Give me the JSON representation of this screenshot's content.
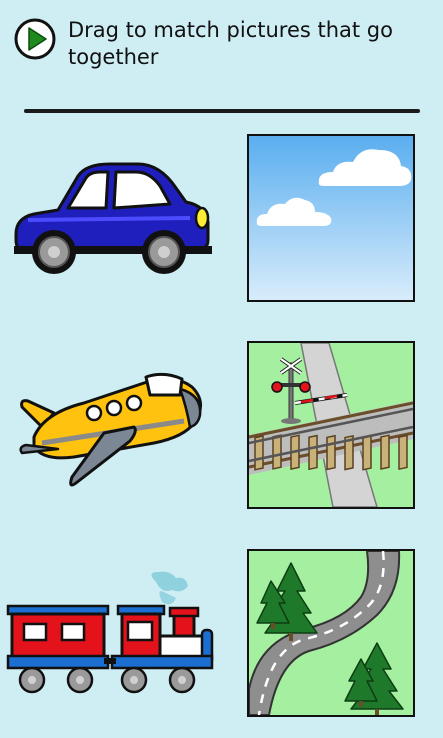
{
  "header": {
    "instruction_text": "Drag to match pictures that go together",
    "play_icon": "play-icon"
  },
  "left_items": [
    {
      "name": "car",
      "icon": "car-icon"
    },
    {
      "name": "airplane",
      "icon": "airplane-icon"
    },
    {
      "name": "train",
      "icon": "train-icon"
    }
  ],
  "right_tiles": [
    {
      "name": "sky",
      "icon": "sky-with-clouds-icon"
    },
    {
      "name": "railroad-crossing",
      "icon": "railroad-crossing-icon"
    },
    {
      "name": "road",
      "icon": "winding-road-icon"
    }
  ],
  "colors": {
    "background": "#cfeef3",
    "play_green": "#1e8a1e",
    "car_blue": "#1f1fbd",
    "plane_yellow": "#ffc20e",
    "train_red": "#e3121b",
    "train_blue": "#1b6fd0",
    "sky_blue": "#6fb8f0",
    "grass_green": "#a5f0a0"
  }
}
